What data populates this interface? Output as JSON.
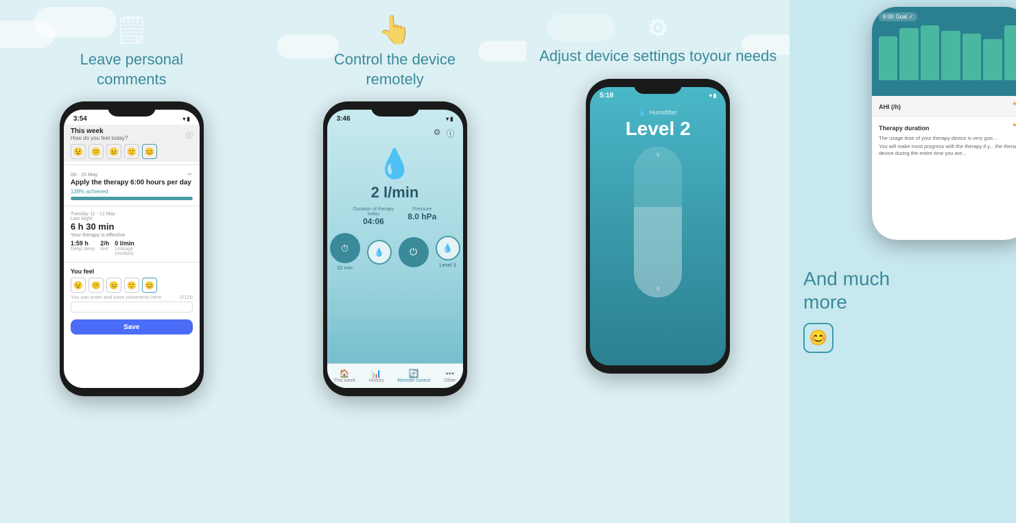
{
  "panels": [
    {
      "id": "panel1",
      "heading": "Leave personal\ncomments",
      "phone": {
        "time": "3:54",
        "screen": "comments",
        "week_label": "This week",
        "week_sub": "How do you feel today?",
        "emojis": [
          "😟",
          "😕",
          "😐",
          "🙂",
          "😊"
        ],
        "date_range": "09 - 15 May",
        "goal_title": "Apply the therapy 6:00 hours per day",
        "achieved": "138% achieved",
        "night_date": "Tuesday 11 - 12 May",
        "night_label": "Last Night",
        "duration": "6 h 30 min",
        "therapy_status": "Your therapy is effective",
        "stats": [
          {
            "val": "1:59 h",
            "lbl": "Deep sleep"
          },
          {
            "val": "2/h",
            "lbl": "AHI"
          },
          {
            "val": "0 l/min",
            "lbl": "Leakage\n(median)"
          }
        ],
        "feel_label": "You feel",
        "comment_hint": "You can enter and save comments here",
        "comment_count": "0/120",
        "save_btn": "Save"
      }
    },
    {
      "id": "panel2",
      "heading": "Control the device\nremotely",
      "phone": {
        "time": "3:46",
        "screen": "remote",
        "flow_value": "2 l/min",
        "duration_label": "Duration of therapy\ntoday",
        "duration_value": "04:06",
        "pressure_label": "Pressure",
        "pressure_value": "8.0 hPa",
        "control_labels": [
          "22 min",
          "",
          "Level 3"
        ],
        "tabs": [
          "This week",
          "History",
          "Remote control",
          "Other"
        ]
      }
    },
    {
      "id": "panel3",
      "heading": "Adjust device settings to\nyour needs",
      "phone": {
        "time": "5:18",
        "screen": "settings",
        "device_label": "Humidifier",
        "level_title": "Level 2",
        "slider_top": "5",
        "slider_bot": "0"
      }
    }
  ],
  "last_panel": {
    "heading": "And much\nmore",
    "chart": {
      "goal_label": "6:00",
      "goal_check": "Goal ✓",
      "bars": [
        80,
        95,
        100,
        90,
        85,
        75,
        100
      ],
      "ahi_label": "AHI (/h)",
      "stars": "★★"
    },
    "therapy": {
      "title": "Therapy duration",
      "stars": "★★",
      "text1": "The usage time of your therapy device is very goo...",
      "text2": "You will make most progress with the therapy if y... the therapy device during the entire time you are..."
    }
  }
}
